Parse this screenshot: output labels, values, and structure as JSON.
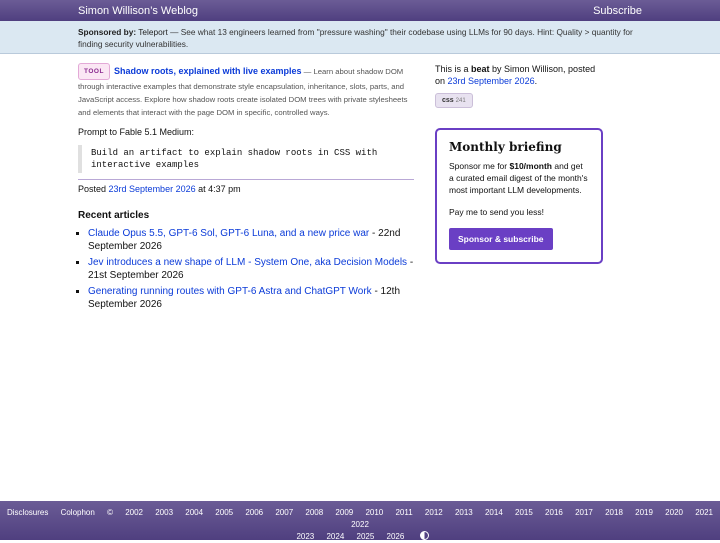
{
  "header": {
    "site_title": "Simon Willison’s Weblog",
    "subscribe_label": "Subscribe"
  },
  "sponsor": {
    "prefix": "Sponsored by:",
    "name": "Teleport",
    "text": " — See what 13 engineers learned from \"pressure washing\" their codebase using LLMs for 90 days. Hint: Quality > quantity for finding security vulnerabilities."
  },
  "main": {
    "tool_badge": "TOOL",
    "tool_title": "Shadow roots, explained with live examples",
    "tool_desc": " — Learn about shadow DOM through interactive examples that demonstrate style encapsulation, inheritance, slots, parts, and JavaScript access. Explore how shadow roots create isolated DOM trees with private stylesheets and elements that interact with the page DOM in specific, controlled ways.",
    "prompt_label": "Prompt to Fable 5.1 Medium:",
    "code": "Build an artifact to explain shadow roots in CSS with\ninteractive examples",
    "posted_prefix": "Posted ",
    "posted_date": "23rd September 2026",
    "posted_time": " at 4:37 pm",
    "recent_heading": "Recent articles",
    "recent": [
      {
        "title": "Claude Opus 5.5, GPT-6 Sol, GPT-6 Luna, and a new price war",
        "date": " - 22nd September 2026"
      },
      {
        "title": "Jev introduces a new shape of LLM - System One, aka Decision Models",
        "date": " - 21st September 2026"
      },
      {
        "title": "Generating running routes with GPT-6 Astra and ChatGPT Work",
        "date": " - 12th September 2026"
      }
    ]
  },
  "side": {
    "beat_pre": "This is a ",
    "beat_word": "beat",
    "beat_post": " by Simon Willison, posted on ",
    "beat_date": "23rd September 2026",
    "beat_end": ".",
    "tag_name": "css",
    "tag_count": "241",
    "briefing_title": "Monthly briefing",
    "briefing_p1_pre": "Sponsor me for ",
    "briefing_price": "$10/month",
    "briefing_p1_post": " and get a curated email digest of the month's most important LLM developments.",
    "briefing_p2": "Pay me to send you less!",
    "briefing_button": "Sponsor & subscribe"
  },
  "footer": {
    "links": [
      "Disclosures",
      "Colophon",
      "©",
      "2002",
      "2003",
      "2004",
      "2005",
      "2006",
      "2007",
      "2008",
      "2009",
      "2010",
      "2011",
      "2012",
      "2013",
      "2014",
      "2015",
      "2016",
      "2017",
      "2018",
      "2019",
      "2020",
      "2021",
      "2022"
    ],
    "links2": [
      "2023",
      "2024",
      "2025",
      "2026"
    ],
    "contrast_icon": "contrast-icon"
  },
  "colors": {
    "header_bg": "#5b4b8a",
    "accent": "#6a3fc4",
    "link": "#0b3bd8",
    "sponsor_bg": "#dbe8f2"
  }
}
